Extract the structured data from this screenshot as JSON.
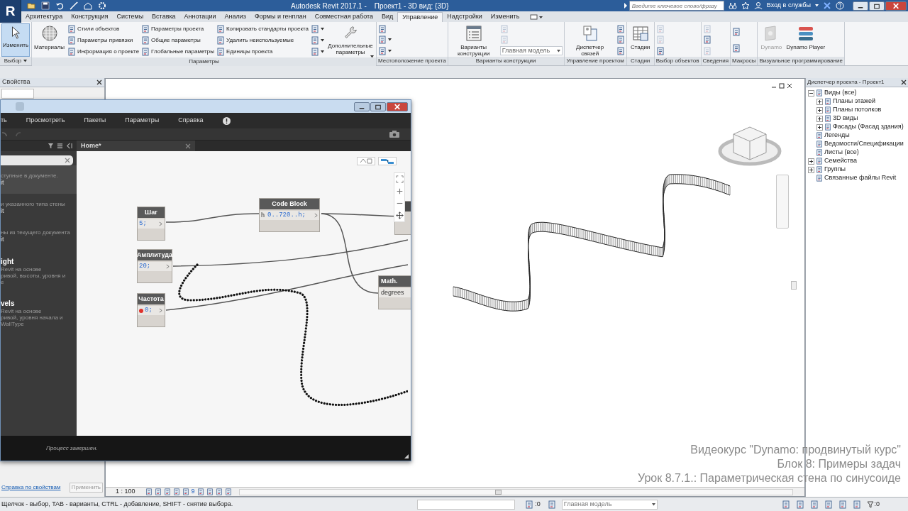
{
  "title_bar": {
    "logo": "R",
    "title": "Autodesk Revit 2017.1 -    Проект1 - 3D вид: {3D}",
    "search": {
      "placeholder": "Введите ключевое слово/фразу"
    },
    "sign_in": "Вход в службы"
  },
  "ribbon_tabs": [
    {
      "label": "Архитектура",
      "selected": false
    },
    {
      "label": "Конструкция",
      "selected": false
    },
    {
      "label": "Системы",
      "selected": false
    },
    {
      "label": "Вставка",
      "selected": false
    },
    {
      "label": "Аннотации",
      "selected": false
    },
    {
      "label": "Анализ",
      "selected": false
    },
    {
      "label": "Формы и генплан",
      "selected": false
    },
    {
      "label": "Совместная работа",
      "selected": false
    },
    {
      "label": "Вид",
      "selected": false
    },
    {
      "label": "Управление",
      "selected": true
    },
    {
      "label": "Надстройки",
      "selected": false
    },
    {
      "label": "Изменить",
      "selected": false
    }
  ],
  "ribbon_groups": [
    {
      "label": "Выбор",
      "menu": true,
      "items": [
        {
          "kind": "large",
          "label": "Изменить",
          "active": true,
          "disabled": false,
          "menu": false
        }
      ]
    },
    {
      "label": "Параметры",
      "menu": false,
      "items": [
        {
          "kind": "large",
          "label": "Материалы",
          "active": false,
          "disabled": false,
          "menu": false
        },
        {
          "kind": "column",
          "items": [
            {
              "label": "Стили объектов"
            },
            {
              "label": "Параметры привязки"
            },
            {
              "label": "Информация о проекте"
            }
          ]
        },
        {
          "kind": "column",
          "items": [
            {
              "label": "Параметры проекта"
            },
            {
              "label": "Общие параметры"
            },
            {
              "label": "Глобальные  параметры"
            }
          ]
        },
        {
          "kind": "column",
          "items": [
            {
              "label": "Копировать стандарты проекта"
            },
            {
              "label": "Удалить неиспользуемые"
            },
            {
              "label": "Единицы проекта"
            }
          ]
        },
        {
          "kind": "icon_column",
          "items": [
            {
              "disabled": false,
              "menu": true
            },
            {
              "disabled": false,
              "menu": true
            },
            {
              "disabled": false,
              "menu": true
            }
          ]
        },
        {
          "kind": "large",
          "label": "Дополнительные параметры",
          "active": false,
          "disabled": false,
          "menu": true
        }
      ]
    },
    {
      "label": "Местоположение проекта",
      "menu": false,
      "items": [
        {
          "kind": "icon_column",
          "items": [
            {
              "disabled": false,
              "menu": false
            },
            {
              "disabled": false,
              "menu": true
            },
            {
              "disabled": false,
              "menu": true
            }
          ]
        }
      ]
    },
    {
      "label": "Варианты конструкции",
      "menu": false,
      "items": [
        {
          "kind": "large",
          "label": "Варианты конструкции",
          "active": false,
          "disabled": false,
          "menu": false
        },
        {
          "kind": "icon_column",
          "items": [
            {
              "disabled": true,
              "menu": false
            },
            {
              "disabled": true,
              "menu": false
            }
          ],
          "select": "Главная модель"
        }
      ]
    },
    {
      "label": "Управление проектом",
      "menu": false,
      "items": [
        {
          "kind": "large",
          "label": "Диспетчер связей",
          "active": false,
          "disabled": false,
          "menu": false
        },
        {
          "kind": "icon_column",
          "items": [
            {
              "disabled": false,
              "menu": false
            },
            {
              "disabled": false,
              "menu": false
            },
            {
              "disabled": false,
              "menu": false
            }
          ]
        }
      ]
    },
    {
      "label": "Стадии",
      "menu": false,
      "items": [
        {
          "kind": "large",
          "label": "Стадии",
          "active": false,
          "disabled": false,
          "menu": false
        }
      ]
    },
    {
      "label": "Выбор объектов",
      "menu": false,
      "items": [
        {
          "kind": "icon_column",
          "items": [
            {
              "disabled": true,
              "menu": false
            },
            {
              "disabled": true,
              "menu": false
            },
            {
              "disabled": false,
              "menu": false
            }
          ]
        }
      ]
    },
    {
      "label": "Сведения",
      "menu": false,
      "items": [
        {
          "kind": "icon_column",
          "items": [
            {
              "disabled": true,
              "menu": false
            },
            {
              "disabled": false,
              "menu": false
            },
            {
              "disabled": true,
              "menu": false
            }
          ]
        }
      ]
    },
    {
      "label": "Макросы",
      "menu": false,
      "items": [
        {
          "kind": "icon_column",
          "items": [
            {
              "disabled": false,
              "menu": false
            },
            {
              "disabled": false,
              "menu": false
            }
          ]
        }
      ]
    },
    {
      "label": "Визуальное программирование",
      "menu": false,
      "items": [
        {
          "kind": "large",
          "label": "Dynamo",
          "active": false,
          "disabled": true,
          "menu": false
        },
        {
          "kind": "large",
          "label": "Dynamo Player",
          "active": false,
          "disabled": false,
          "menu": false
        }
      ]
    }
  ],
  "properties": {
    "title": "Свойства",
    "help_link": "Справка по свойствам",
    "apply_button": "Применить"
  },
  "view": {
    "scale": "1 : 100",
    "marker": "9"
  },
  "project_browser": {
    "title": "Диспетчер проекта - Проект1",
    "tree": [
      {
        "label": "Виды (все)",
        "kind": "group",
        "expanded": true,
        "children": [
          {
            "label": "Планы этажей",
            "kind": "group",
            "expanded": false
          },
          {
            "label": "Планы потолков",
            "kind": "group",
            "expanded": false
          },
          {
            "label": "3D виды",
            "kind": "group",
            "expanded": false
          },
          {
            "label": "Фасады (Фасад здания)",
            "kind": "group",
            "expanded": false
          }
        ]
      },
      {
        "label": "Легенды",
        "kind": "leaf"
      },
      {
        "label": "Ведомости/Спецификации",
        "kind": "leaf"
      },
      {
        "label": "Листы (все)",
        "kind": "leaf"
      },
      {
        "label": "Семейства",
        "kind": "group",
        "expanded": false
      },
      {
        "label": "Группы",
        "kind": "group",
        "expanded": false
      },
      {
        "label": "Связанные файлы Revit",
        "kind": "leaf"
      }
    ]
  },
  "dynamo": {
    "menu": [
      "ть",
      "Просмотреть",
      "Пакеты",
      "Параметры",
      "Справка"
    ],
    "library": [
      {
        "lines": [
          "ступные в документе."
        ],
        "source": "it",
        "selected": true
      },
      {
        "lines": [
          "и указанного типа стены"
        ],
        "source": "it",
        "selected": false
      },
      {
        "lines": [
          "ны из текущего документа"
        ],
        "source": "it",
        "selected": false
      },
      {
        "title": "ight",
        "lines": [
          "Revit на основе",
          "ривой, высоты, уровня и",
          "е"
        ],
        "selected": false
      },
      {
        "title": "vels",
        "lines": [
          "Revit на основе",
          "ривой, уровня начала и",
          "WallType"
        ],
        "selected": false
      }
    ],
    "tab": "Home*",
    "nodes": [
      {
        "kind": "number",
        "title": "Шаг",
        "value": "5;"
      },
      {
        "kind": "number",
        "title": "Амплитуда",
        "value": "20;"
      },
      {
        "kind": "number",
        "title": "Частота",
        "value": "0;",
        "marked": true
      },
      {
        "kind": "code",
        "title": "Code Block",
        "input": "h",
        "value": "0..720..h;"
      },
      {
        "kind": "function",
        "title": "Math.",
        "input": "degrees"
      },
      {
        "kind": "blank"
      }
    ],
    "status": "Процесс завершен."
  },
  "status_bar": {
    "hint": "Щелчок - выбор, TAB - варианты, CTRL - добавление, SHIFT - снятие выбора.",
    "editable_count": ":0",
    "design_option": "Главная модель",
    "filter_count": ":0"
  },
  "video_caption": [
    "Видеокурс \"Dynamo: продвинутый курс\"",
    "Блок 8: Примеры задач",
    "Урок 8.7.1.: Параметрическая стена по синусоиде"
  ]
}
